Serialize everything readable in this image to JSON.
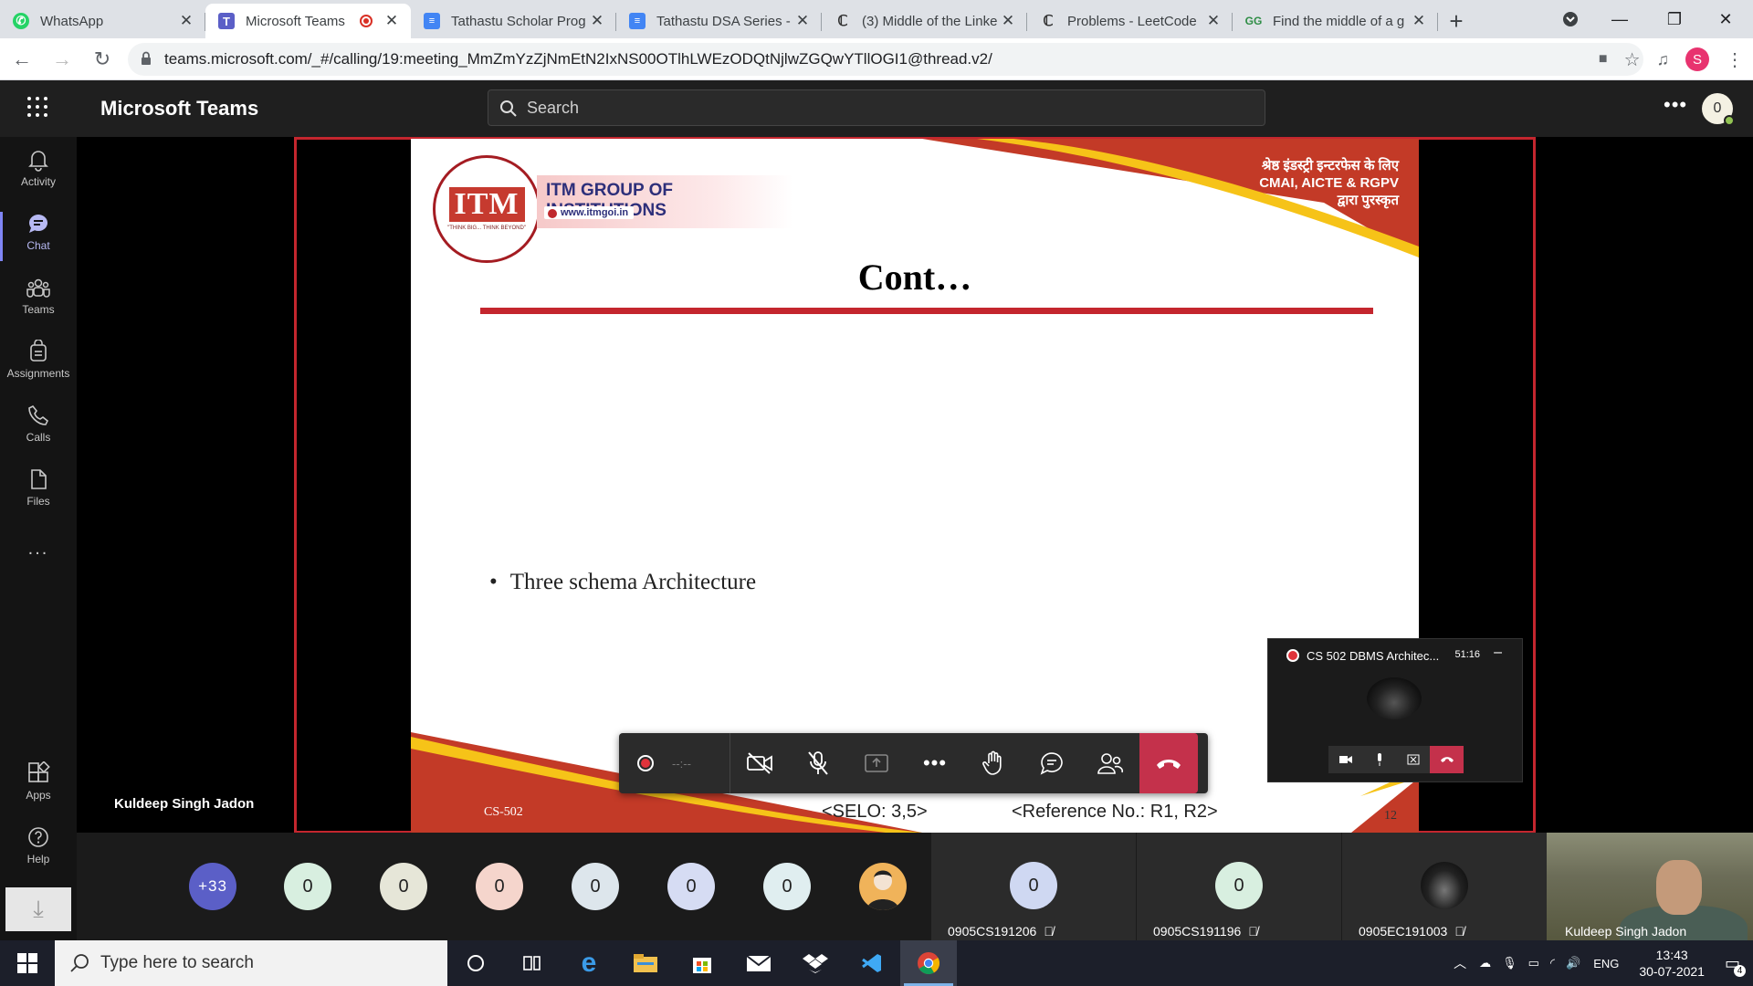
{
  "browser": {
    "tabs": [
      {
        "title": "WhatsApp",
        "icon": "whatsapp-icon",
        "color": "#25d366"
      },
      {
        "title": "Microsoft Teams",
        "icon": "teams-icon",
        "color": "#5b5fc7",
        "recording": true
      },
      {
        "title": "Tathastu Scholar Prog",
        "icon": "docs-icon",
        "color": "#4285f4"
      },
      {
        "title": "Tathastu DSA Series - ",
        "icon": "docs-icon",
        "color": "#4285f4"
      },
      {
        "title": "(3) Middle of the Linke",
        "icon": "leetcode-icon",
        "color": "#333"
      },
      {
        "title": "Problems - LeetCode",
        "icon": "leetcode-icon",
        "color": "#333"
      },
      {
        "title": "Find the middle of a g",
        "icon": "gfg-icon",
        "color": "#2f8d46"
      }
    ],
    "new_tab": "+",
    "url": "teams.microsoft.com/_#/calling/19:meeting_MmZmYzZjNmEtN2IxNS00OTlhLWEzODQtNjlwZGQwYTllOGI1@thread.v2/",
    "profile_initial": "S"
  },
  "teams": {
    "brand": "Microsoft Teams",
    "search_placeholder": "Search",
    "avatar_initial": "0",
    "rail": [
      {
        "label": "Activity",
        "icon": "bell-icon"
      },
      {
        "label": "Chat",
        "icon": "chat-icon"
      },
      {
        "label": "Teams",
        "icon": "teams-people-icon"
      },
      {
        "label": "Assignments",
        "icon": "assignments-icon"
      },
      {
        "label": "Calls",
        "icon": "phone-icon"
      },
      {
        "label": "Files",
        "icon": "file-icon"
      },
      {
        "label": "...",
        "icon": "more-icon"
      },
      {
        "label": "Apps",
        "icon": "apps-icon"
      },
      {
        "label": "Help",
        "icon": "help-icon"
      }
    ]
  },
  "slide": {
    "logo_text": "ITM",
    "logo_tagline": "\"THINK BIG... THINK BEYOND\"",
    "institution": "ITM GROUP OF INSTITUTIONS",
    "website": "www.itmgoi.in",
    "hindi_line1": "श्रेष्ठ इंडस्ट्री इन्टरफेस के लिए",
    "hindi_line2": "CMAI, AICTE & RGPV",
    "hindi_line3": "द्वारा पुरस्कृत",
    "title": "Cont…",
    "bullet": "Three schema Architecture",
    "course_code": "CS-502",
    "selo": "<SELO: 3,5>",
    "reference": "<Reference No.: R1, R2>",
    "page": "12"
  },
  "presenter_name": "Kuldeep Singh Jadon",
  "controls": {
    "rec_time": "--:--"
  },
  "mini_window": {
    "title": "CS 502 DBMS Architec...",
    "time": "51:16",
    "minimize": "–"
  },
  "participants": {
    "overflow": "+33",
    "bubbles": [
      {
        "label": "0",
        "color": "#d8efe0"
      },
      {
        "label": "0",
        "color": "#e6e6d8"
      },
      {
        "label": "0",
        "color": "#f5d5cc"
      },
      {
        "label": "0",
        "color": "#dde6ec"
      },
      {
        "label": "0",
        "color": "#d6dcf3"
      },
      {
        "label": "0",
        "color": "#e0eef0"
      }
    ],
    "tiles": [
      {
        "name": "0905CS191206",
        "initial": "0",
        "color": "#cfd8f2"
      },
      {
        "name": "0905CS191196",
        "initial": "0",
        "color": "#d8efe0"
      },
      {
        "name": "0905EC191003",
        "initial": "",
        "color": "#333"
      }
    ],
    "video_name": "Kuldeep Singh Jadon"
  },
  "taskbar": {
    "search_placeholder": "Type here to search",
    "lang": "ENG",
    "time": "13:43",
    "date": "30-07-2021",
    "notif_count": "4"
  }
}
